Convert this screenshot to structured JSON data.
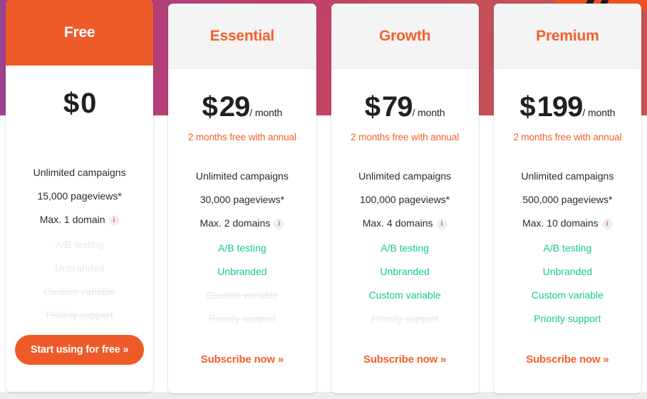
{
  "decor": {
    "banner_gradient_from": "#9a4491",
    "banner_gradient_mid": "#bf3f6c",
    "banner_gradient_to": "#c85350",
    "logo_color": "#ee4f23"
  },
  "theme": {
    "accent_orange": "#f4602a",
    "feature_on_green": "#17c98a",
    "feature_off_grey": "#e8e8e8",
    "price_black": "#231f1e"
  },
  "plans": [
    {
      "name": "Free",
      "featured": true,
      "currency": "$",
      "amount": "0",
      "period": "",
      "note": "",
      "features": [
        {
          "label": "Unlimited campaigns",
          "state": "base",
          "info": false
        },
        {
          "label": "15,000 pageviews*",
          "state": "base",
          "info": false
        },
        {
          "label": "Max. 1 domain",
          "state": "base",
          "info": true,
          "info_glyph": "i"
        },
        {
          "label": "A/B testing",
          "state": "off",
          "struck": false
        },
        {
          "label": "Unbranded",
          "state": "off",
          "struck": false
        },
        {
          "label": "Custom variable",
          "state": "off",
          "struck": true
        },
        {
          "label": "Priority support",
          "state": "off",
          "struck": true
        }
      ],
      "cta": {
        "label": "Start using for free »",
        "style": "button"
      }
    },
    {
      "name": "Essential",
      "featured": false,
      "currency": "$",
      "amount": "29",
      "period": "/ month",
      "note": "2 months free with annual",
      "features": [
        {
          "label": "Unlimited campaigns",
          "state": "base",
          "info": false
        },
        {
          "label": "30,000 pageviews*",
          "state": "base",
          "info": false
        },
        {
          "label": "Max. 2 domains",
          "state": "base",
          "info": true,
          "info_glyph": "i"
        },
        {
          "label": "A/B testing",
          "state": "on",
          "struck": false
        },
        {
          "label": "Unbranded",
          "state": "on",
          "struck": false
        },
        {
          "label": "Custom variable",
          "state": "off",
          "struck": true
        },
        {
          "label": "Priority support",
          "state": "off",
          "struck": true
        }
      ],
      "cta": {
        "label": "Subscribe now »",
        "style": "link"
      }
    },
    {
      "name": "Growth",
      "featured": false,
      "currency": "$",
      "amount": "79",
      "period": "/ month",
      "note": "2 months free with annual",
      "features": [
        {
          "label": "Unlimited campaigns",
          "state": "base",
          "info": false
        },
        {
          "label": "100,000 pageviews*",
          "state": "base",
          "info": false
        },
        {
          "label": "Max. 4 domains",
          "state": "base",
          "info": true,
          "info_glyph": "i"
        },
        {
          "label": "A/B testing",
          "state": "on",
          "struck": false
        },
        {
          "label": "Unbranded",
          "state": "on",
          "struck": false
        },
        {
          "label": "Custom variable",
          "state": "on",
          "struck": false
        },
        {
          "label": "Priority support",
          "state": "off",
          "struck": true
        }
      ],
      "cta": {
        "label": "Subscribe now »",
        "style": "link"
      }
    },
    {
      "name": "Premium",
      "featured": false,
      "currency": "$",
      "amount": "199",
      "period": "/ month",
      "note": "2 months free with annual",
      "features": [
        {
          "label": "Unlimited campaigns",
          "state": "base",
          "info": false
        },
        {
          "label": "500,000 pageviews*",
          "state": "base",
          "info": false
        },
        {
          "label": "Max. 10 domains",
          "state": "base",
          "info": true,
          "info_glyph": "i"
        },
        {
          "label": "A/B testing",
          "state": "on",
          "struck": false
        },
        {
          "label": "Unbranded",
          "state": "on",
          "struck": false
        },
        {
          "label": "Custom variable",
          "state": "on",
          "struck": false
        },
        {
          "label": "Priority support",
          "state": "on",
          "struck": false
        }
      ],
      "cta": {
        "label": "Subscribe now »",
        "style": "link"
      }
    }
  ]
}
